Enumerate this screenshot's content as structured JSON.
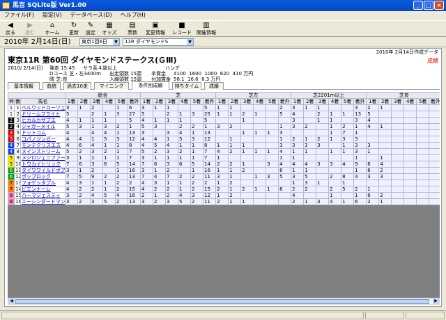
{
  "window": {
    "title": "馬吉 SQLite版  Ver1.00"
  },
  "menu": [
    "ファイル(F)",
    "設定(V)",
    "データベース(D)",
    "ヘルプ(H)"
  ],
  "toolbar": [
    {
      "label": "戻る",
      "icon": "back-arrow-icon",
      "glyph": "◀",
      "enabled": true
    },
    {
      "label": "進む",
      "icon": "forward-arrow-icon",
      "glyph": "▶",
      "enabled": false
    },
    {
      "label": "ホーム",
      "icon": "home-icon",
      "glyph": "⌂",
      "enabled": true
    },
    {
      "label": "更新",
      "icon": "refresh-icon",
      "glyph": "↻",
      "enabled": true
    },
    {
      "label": "設定",
      "icon": "settings-icon",
      "glyph": "✎",
      "enabled": true
    },
    {
      "label": "オッズ",
      "icon": "odds-icon",
      "glyph": "▦",
      "enabled": true
    },
    {
      "label": "票数",
      "icon": "votes-icon",
      "glyph": "▤",
      "enabled": true
    },
    {
      "label": "変更情報",
      "icon": "change-info-icon",
      "glyph": "▣",
      "enabled": true
    },
    {
      "label": "レコード",
      "icon": "record-icon",
      "glyph": "■",
      "enabled": true
    },
    {
      "label": "開催情報",
      "icon": "schedule-icon",
      "glyph": "▥",
      "enabled": true
    }
  ],
  "datebar": {
    "date": "2010年 2月14日(日)",
    "venue": "東京1回6日",
    "race": "11R ダイヤモンドS"
  },
  "race": {
    "made_date": "2010年 2月14日作成データ",
    "title": "東京11R 第60回 ダイヤモンドステークス(ＧⅢ)",
    "grade_note": "成績",
    "date": "2010/ 2/14(日)",
    "post_time": "発走 15:45",
    "cond": "サラ系４歳以上",
    "handicap": "ハンデ",
    "course": "Dコース 芝・左3400m",
    "weather": "晴 芝:良",
    "entries1": "出走頭数 15頭",
    "entries2": "入線頭数 15頭",
    "prize_label": "本賞金",
    "add_label": "付加賞金",
    "prize": "4100  1600  1000  620  410 万円",
    "add": "58.1  16.6  8.3 万円"
  },
  "tabs": [
    "基本情報",
    "血統",
    "過去10走",
    "マイニング",
    "条件別成績",
    "持ちタイム",
    "成績"
  ],
  "active_tab": 4,
  "table": {
    "groups": [
      "総合",
      "芝",
      "芝左",
      "芝2201m以上",
      "芝良"
    ],
    "cols": [
      "1着",
      "2着",
      "3着",
      "4着",
      "5着",
      "着外"
    ],
    "head": [
      "枠",
      "番",
      "馬名"
    ],
    "horses": [
      {
        "waku": "1",
        "ban": "1",
        "name": "ベルウッドローツェ",
        "cells": [
          "3",
          "1",
          "2",
          "",
          "1",
          "6",
          "3",
          "1",
          "1",
          "",
          "",
          "5",
          "1",
          "1",
          "",
          "",
          "",
          "2",
          "3",
          "1",
          "1",
          "",
          "",
          "3",
          "2",
          "1"
        ]
      },
      {
        "waku": "1",
        "ban": "2",
        "name": "ドリームフライト",
        "cells": [
          "5",
          "",
          "2",
          "1",
          "3",
          "27",
          "5",
          "",
          "2",
          "1",
          "3",
          "25",
          "1",
          "1",
          "2",
          "1",
          "",
          "5",
          "4",
          "",
          "2",
          "1",
          "1",
          "13",
          "5",
          ""
        ]
      },
      {
        "waku": "2",
        "ban": "3",
        "name": "ヒカルカザブエ",
        "cells": [
          "4",
          "1",
          "1",
          "1",
          "",
          "5",
          "4",
          "1",
          "1",
          "1",
          "",
          "5",
          "",
          "",
          "1",
          "",
          "",
          "",
          "3",
          "",
          "1",
          "1",
          "",
          "3",
          "4",
          ""
        ]
      },
      {
        "waku": "2",
        "ban": "4",
        "name": "ジャガーメイル",
        "cells": [
          "5",
          "3",
          "1",
          "3",
          "2",
          "1",
          "5",
          "3",
          "",
          "2",
          "2",
          "1",
          "3",
          "2",
          "",
          "",
          "",
          "1",
          "3",
          "2",
          "",
          "1",
          "2",
          "1",
          "4",
          "1"
        ]
      },
      {
        "waku": "3",
        "ban": "5",
        "name": "ドットコム",
        "cells": [
          "4",
          "",
          "4",
          "4",
          "1",
          "13",
          "3",
          "",
          "3",
          "4",
          "1",
          "13",
          "",
          "",
          "1",
          "1",
          "1",
          "3",
          "",
          "",
          "",
          "1",
          "7",
          "1",
          "",
          ""
        ]
      },
      {
        "waku": "3",
        "ban": "6",
        "name": "コパノジンガー",
        "cells": [
          "4",
          "4",
          "1",
          "5",
          "3",
          "12",
          "4",
          "4",
          "1",
          "5",
          "3",
          "12",
          "",
          "1",
          "",
          "",
          "",
          "1",
          "2",
          "1",
          "2",
          "1",
          "3",
          "3",
          "",
          ""
        ]
      },
      {
        "waku": "4",
        "ban": "7",
        "name": "モンテクリスエス",
        "cells": [
          "4",
          "6",
          "4",
          "1",
          "1",
          "8",
          "4",
          "5",
          "4",
          "1",
          "1",
          "8",
          "1",
          "1",
          "1",
          "",
          "",
          "3",
          "3",
          "3",
          "3",
          "",
          "1",
          "3",
          "3",
          ""
        ]
      },
      {
        "waku": "4",
        "ban": "8",
        "name": "メインストリーム",
        "cells": [
          "5",
          "2",
          "3",
          "2",
          "1",
          "7",
          "5",
          "2",
          "3",
          "2",
          "1",
          "7",
          "4",
          "2",
          "1",
          "1",
          "1",
          "4",
          "1",
          "1",
          "",
          "1",
          "1",
          "3",
          "1",
          ""
        ]
      },
      {
        "waku": "5",
        "ban": "9",
        "name": "メジロジェニファー",
        "cells": [
          "3",
          "1",
          "1",
          "1",
          "1",
          "7",
          "3",
          "1",
          "1",
          "1",
          "1",
          "7",
          "1",
          "",
          "",
          "",
          "",
          "1",
          "1",
          "",
          "",
          "",
          "",
          "1",
          "",
          "1"
        ]
      },
      {
        "waku": "5",
        "ban": "10",
        "name": "トウカイトリック",
        "cells": [
          "7",
          "6",
          "3",
          "6",
          "5",
          "14",
          "7",
          "6",
          "3",
          "6",
          "5",
          "14",
          "2",
          "2",
          "1",
          "",
          "3",
          "4",
          "4",
          "4",
          "3",
          "3",
          "4",
          "9",
          "6",
          "4"
        ]
      },
      {
        "waku": "6",
        "ban": "11",
        "name": "ダイワワイルドボア",
        "cells": [
          "3",
          "1",
          "2",
          "",
          "1",
          "16",
          "3",
          "1",
          "2",
          "",
          "1",
          "16",
          "1",
          "1",
          "2",
          "",
          "",
          "6",
          "1",
          "1",
          "",
          "",
          "",
          "1",
          "6",
          "2"
        ]
      },
      {
        "waku": "6",
        "ban": "12",
        "name": "ポップロック",
        "cells": [
          "7",
          "5",
          "9",
          "2",
          "2",
          "13",
          "7",
          "4",
          "7",
          "2",
          "2",
          "11",
          "3",
          "1",
          "",
          "1",
          "3",
          "5",
          "3",
          "5",
          "",
          "2",
          "8",
          "4",
          "3",
          "3"
        ]
      },
      {
        "waku": "7",
        "ban": "13",
        "name": "フォゲッタブル",
        "cells": [
          "4",
          "3",
          "1",
          "1",
          "2",
          "2",
          "4",
          "3",
          "1",
          "1",
          "2",
          "2",
          "1",
          "2",
          "",
          "",
          "",
          "",
          "1",
          "3",
          "1",
          "",
          "1",
          "",
          "",
          ""
        ]
      },
      {
        "waku": "7",
        "ban": "14",
        "name": "ビエンナーレ",
        "cells": [
          "4",
          "2",
          "2",
          "1",
          "2",
          "15",
          "4",
          "2",
          "2",
          "1",
          "2",
          "15",
          "2",
          "1",
          "2",
          "1",
          "1",
          "6",
          "2",
          "2",
          "",
          "2",
          "5",
          "2",
          "1",
          ""
        ]
      },
      {
        "waku": "8",
        "ban": "15",
        "name": "ハーマジェスティ",
        "cells": [
          "3",
          "2",
          "4",
          "5",
          "4",
          "16",
          "2",
          "1",
          "2",
          "4",
          "3",
          "12",
          "1",
          "2",
          "",
          "",
          "",
          "",
          "4",
          "",
          "",
          "1",
          "",
          "1",
          "6",
          "2"
        ]
      },
      {
        "waku": "8",
        "ban": "16",
        "name": "エーシンダードマン",
        "cells": [
          "3",
          "2",
          "3",
          "5",
          "2",
          "13",
          "3",
          "2",
          "3",
          "5",
          "2",
          "11",
          "2",
          "1",
          "1",
          "",
          "",
          "",
          "2",
          "1",
          "3",
          "4",
          "1",
          "6",
          "2",
          "1"
        ]
      }
    ]
  },
  "colors": {
    "waku1": "#ffffff",
    "waku2": "#000000",
    "waku3": "#e00000",
    "waku4": "#0040ff",
    "waku5": "#ffee00",
    "waku6": "#00a000",
    "waku7": "#ff8000",
    "waku8": "#ff80c0",
    "title_blue": "#0446c4",
    "link": "#0000cc"
  }
}
